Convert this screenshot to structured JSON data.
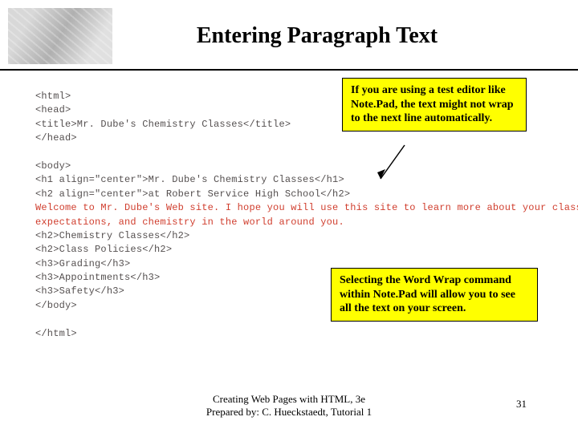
{
  "slide": {
    "title": "Entering Paragraph Text"
  },
  "callouts": {
    "top": "If you are using a test editor like Note.Pad, the text might not wrap to the next line automatically.",
    "bottom": "Selecting the Word Wrap command within Note.Pad will allow you to see all the text on your screen."
  },
  "code": {
    "l1": "<html>",
    "l2": "<head>",
    "l3": "<title>Mr. Dube's Chemistry Classes</title>",
    "l4": "</head>",
    "l5": "",
    "l6": "<body>",
    "l7": "<h1 align=\"center\">Mr. Dube's Chemistry Classes</h1>",
    "l8": "<h2 align=\"center\">at Robert Service High School</h2>",
    "red1": "Welcome to Mr. Dube's Web site. I hope you will use this site to learn more about your class, my",
    "red2": "expectations, and chemistry in the world around you.",
    "l9": "<h2>Chemistry Classes</h2>",
    "l10": "<h2>Class Policies</h2>",
    "l11": "<h3>Grading</h3>",
    "l12": "<h3>Appointments</h3>",
    "l13": "<h3>Safety</h3>",
    "l14": "</body>",
    "l15": "",
    "l16": "</html>"
  },
  "footer": {
    "line1": "Creating Web Pages with HTML, 3e",
    "line2": "Prepared by: C. Hueckstaedt, Tutorial 1",
    "page": "31"
  }
}
